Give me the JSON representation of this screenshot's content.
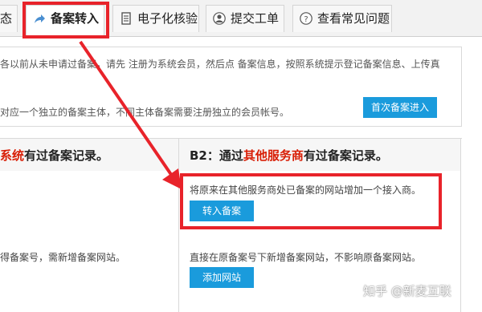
{
  "tabs": {
    "partial": "态",
    "transfer": "备案转入",
    "verify": "电子化核验",
    "submit": "提交工单",
    "faq": "查看常见问题"
  },
  "top": {
    "line1": "各以前从未申请过备案，请先 注册为系统会员，然后点 备案信息，按照系统提示登记备案信息、上传真",
    "line2": "对应一个独立的备案主体，不同主体备案需要注册独立的会员帐号。",
    "first_button": "首次备案进入"
  },
  "b1": {
    "header_red": "系统",
    "header_rest": "有过备案记录。",
    "desc2": "得备案号，需新增备案网站。"
  },
  "b2": {
    "header_prefix": "B2：通过",
    "header_red": "其他服务商",
    "header_rest": "有过备案记录。",
    "desc1": "将原来在其他服务商处已备案的网站增加一个接入商。",
    "transfer_button": "转入备案",
    "desc2": "直接在原备案号下新增备案网站，不影响原备案网站。",
    "add_button": "添加网站"
  },
  "watermark": "知乎 @新麦互联",
  "colors": {
    "accent": "#1a9bdc",
    "annotation": "#e8232a",
    "highlight_text": "#d81e06"
  },
  "icons": [
    "share-arrow-icon",
    "document-icon",
    "user-icon",
    "question-icon"
  ]
}
